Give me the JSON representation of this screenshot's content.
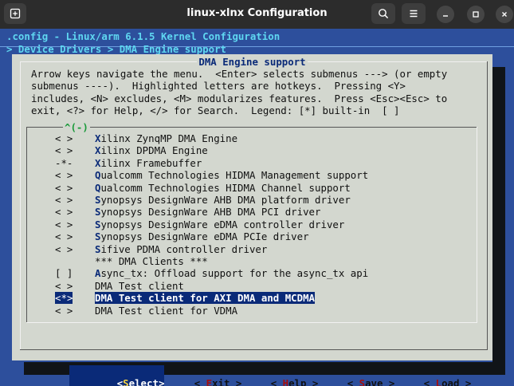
{
  "window": {
    "title": "linux-xlnx Configuration",
    "colors": {
      "titlebar": "#2c2c2c",
      "terminal_bg": "#2d4f9c",
      "dialog_bg": "#d3d7cf",
      "highlight": "#0a2a78",
      "hotkey": "#f6d545",
      "button_hotkey": "#a60d0d"
    }
  },
  "header": {
    "config_line": ".config - Linux/arm 6.1.5 Kernel Configuration",
    "breadcrumb": "> Device Drivers > DMA Engine support"
  },
  "dialog": {
    "title": "DMA Engine support",
    "help": "Arrow keys navigate the menu.  <Enter> selects submenus ---> (or empty\nsubmenus ----).  Highlighted letters are hotkeys.  Pressing <Y>\nincludes, <N> excludes, <M> modularizes features.  Press <Esc><Esc> to\nexit, <?> for Help, </> for Search.  Legend: [*] built-in  [ ]",
    "scroll_indicator": "^(-)",
    "items": [
      {
        "mark": "< >",
        "hot": "X",
        "rest": "ilinx ZynqMP DMA Engine"
      },
      {
        "mark": "< >",
        "hot": "X",
        "rest": "ilinx DPDMA Engine"
      },
      {
        "mark": "-*-",
        "hot": "X",
        "rest": "ilinx Framebuffer"
      },
      {
        "mark": "< >",
        "hot": "Q",
        "rest": "ualcomm Technologies HIDMA Management support"
      },
      {
        "mark": "< >",
        "hot": "Q",
        "rest": "ualcomm Technologies HIDMA Channel support"
      },
      {
        "mark": "< >",
        "hot": "S",
        "rest": "ynopsys DesignWare AHB DMA platform driver"
      },
      {
        "mark": "< >",
        "hot": "S",
        "rest": "ynopsys DesignWare AHB DMA PCI driver"
      },
      {
        "mark": "< >",
        "hot": "S",
        "rest": "ynopsys DesignWare eDMA controller driver"
      },
      {
        "mark": "< >",
        "hot": "S",
        "rest": "ynopsys DesignWare eDMA PCIe driver"
      },
      {
        "mark": "< >",
        "hot": "S",
        "rest": "ifive PDMA controller driver"
      },
      {
        "mark": "",
        "hot": "",
        "rest": "*** DMA Clients ***"
      },
      {
        "mark": "[ ]",
        "hot": "A",
        "rest": "sync_tx: Offload support for the async_tx api"
      },
      {
        "mark": "< >",
        "hot": "",
        "rest": "DMA Test client"
      },
      {
        "mark": "<*>",
        "hot": "",
        "rest": "DMA Test client for AXI DMA and MCDMA",
        "selected": true
      },
      {
        "mark": "< >",
        "hot": "",
        "rest": "DMA Test client for VDMA"
      }
    ]
  },
  "buttons": {
    "select": {
      "open": "<",
      "hot": "S",
      "rest": "elect",
      "close": ">"
    },
    "exit": {
      "open": "< ",
      "hot": "E",
      "rest": "xit",
      "close": " >"
    },
    "help": {
      "open": "< ",
      "hot": "H",
      "rest": "elp",
      "close": " >"
    },
    "save": {
      "open": "< ",
      "hot": "S",
      "rest": "ave",
      "close": " >"
    },
    "load": {
      "open": "< ",
      "hot": "L",
      "rest": "oad",
      "close": " >"
    }
  }
}
